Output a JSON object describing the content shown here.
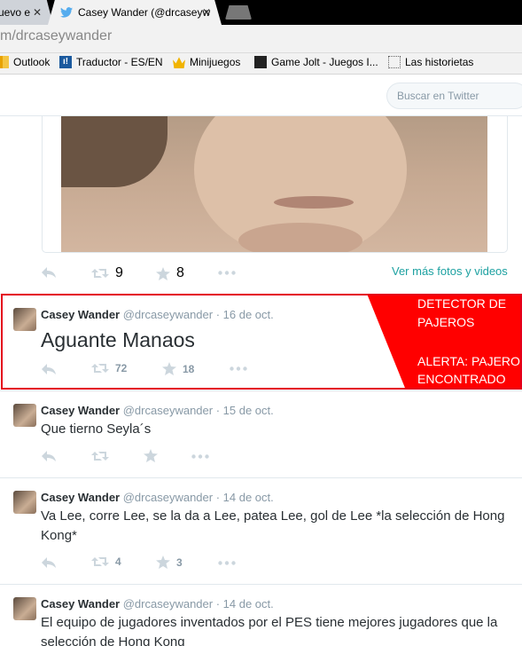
{
  "browser": {
    "tabs": [
      {
        "label": "uevo e",
        "close": "✕"
      },
      {
        "label": "Casey Wander (@drcaseyw",
        "close": "✕"
      }
    ],
    "url_prefix": "m/",
    "url_host": "drcaseywander",
    "bookmarks": [
      "Outlook",
      "Traductor - ES/EN",
      "Minijuegos",
      "Game Jolt - Juegos I...",
      "Las historietas"
    ]
  },
  "twitter": {
    "search_placeholder": "Buscar en Twitter"
  },
  "photo_tweet": {
    "retweets": "9",
    "favorites": "8",
    "view_more": "Ver más fotos y videos"
  },
  "tweets": [
    {
      "name": "Casey Wander",
      "handle": "@drcaseywander",
      "date": "· 16 de oct.",
      "text": "Aguante Manaos",
      "retweets": "72",
      "favorites": "18"
    },
    {
      "name": "Casey Wander",
      "handle": "@drcaseywander",
      "date": "· 15 de oct.",
      "text": "Que tierno Seyla´s",
      "retweets": "",
      "favorites": ""
    },
    {
      "name": "Casey Wander",
      "handle": "@drcaseywander",
      "date": "· 14 de oct.",
      "text": "Va Lee, corre Lee, se la da a Lee, patea Lee, gol de Lee *la selección de Hong Kong*",
      "retweets": "4",
      "favorites": "3"
    },
    {
      "name": "Casey Wander",
      "handle": "@drcaseywander",
      "date": "· 14 de oct.",
      "text": "El equipo de jugadores inventados por el PES tiene mejores jugadores que la selección de Hong Kong"
    }
  ],
  "overlay": {
    "line1": "DETECTOR DE",
    "line2": "PAJEROS",
    "line3": "ALERTA: PAJERO",
    "line4": "ENCONTRADO"
  },
  "colors": {
    "twitter_blue": "#55acee",
    "alert_red": "#ff0000",
    "link_teal": "#1da1a1"
  }
}
